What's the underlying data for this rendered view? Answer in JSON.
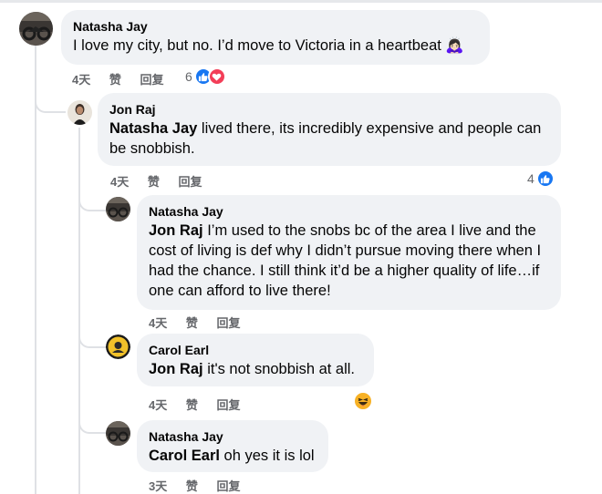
{
  "comments": [
    {
      "author": "Natasha Jay",
      "text": "I love my city, but no. I’d move to Victoria in a heartbeat 🙇🏻‍♀️",
      "time": "4天",
      "like": "赞",
      "reply": "回复",
      "reaction_count": "6",
      "reactions": [
        "like-icon",
        "love-icon"
      ]
    },
    {
      "author": "Jon Raj",
      "mention": "Natasha Jay",
      "text": " lived there, its incredibly expensive and people can be snobbish.",
      "time": "4天",
      "like": "赞",
      "reply": "回复",
      "reaction_count": "4",
      "reactions": [
        "like-icon"
      ]
    },
    {
      "author": "Natasha Jay",
      "mention": "Jon Raj",
      "text": " I’m used to the snobs bc of the area I live and the cost of living is def why I didn’t pursue moving there when I had the chance. I still think it’d be a higher quality of life…if one can afford to live there!",
      "time": "4天",
      "like": "赞",
      "reply": "回复"
    },
    {
      "author": "Carol Earl",
      "mention": "Jon Raj",
      "text": " it's not snobbish at all.",
      "time": "4天",
      "like": "赞",
      "reply": "回复",
      "reactions": [
        "haha-icon"
      ]
    },
    {
      "author": "Natasha Jay",
      "mention": "Carol Earl",
      "text": " oh yes it is lol",
      "time": "3天",
      "like": "赞",
      "reply": "回复"
    }
  ],
  "colors": {
    "like": "#1877f2",
    "love": "#f33e58",
    "haha": "#f7b125",
    "bubble": "#f0f2f5",
    "meta": "#65676b"
  }
}
